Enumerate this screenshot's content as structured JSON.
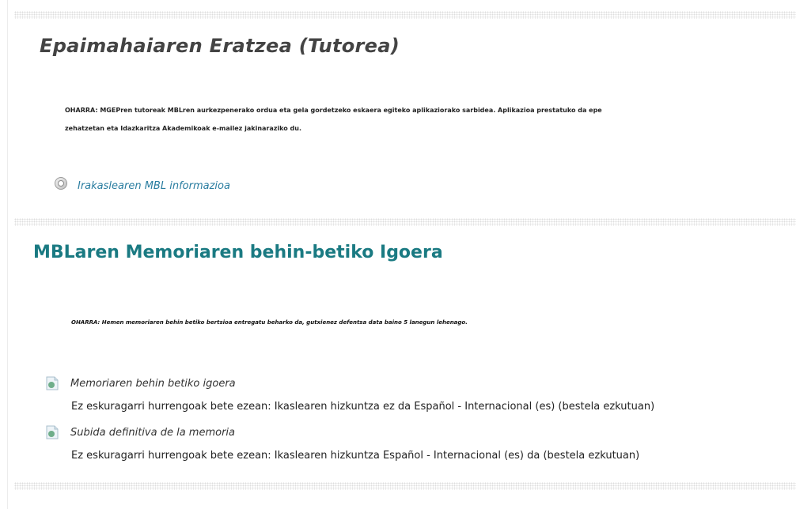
{
  "section1": {
    "title": "Epaimahaiaren Eratzea (Tutorea)",
    "note_line1": "OHARRA: MGEPren tutoreak MBLren aurkezpenerako ordua eta gela gordetzeko eskaera egiteko aplikaziorako sarbidea. Aplikazioa prestatuko da epe",
    "note_line2": "zehatzetan eta Idazkaritza Akademikoak e-mailez jakinaraziko du.",
    "link_label": "Irakaslearen MBL informazioa",
    "link_icon": "page-icon"
  },
  "section2": {
    "title": "MBLaren Memoriaren behin-betiko Igoera",
    "note": "OHARRA: Hemen memoriaren behin betiko bertsioa entregatu beharko da, gutxienez defentsa data baino 5 lanegun lehenago.",
    "activities": [
      {
        "label": "Memoriaren behin betiko igoera",
        "restriction": "Ez eskuragarri hurrengoak bete ezean: Ikaslearen hizkuntza ez da Español - Internacional (es) (bestela ezkutuan)",
        "icon": "assignment-icon"
      },
      {
        "label": "Subida definitiva de la memoria",
        "restriction": "Ez eskuragarri hurrengoak bete ezean: Ikaslearen hizkuntza Español - Internacional (es) da (bestela ezkutuan)",
        "icon": "assignment-icon"
      }
    ]
  },
  "colors": {
    "section2_title": "#1a7a82",
    "link": "#2a7da0"
  }
}
